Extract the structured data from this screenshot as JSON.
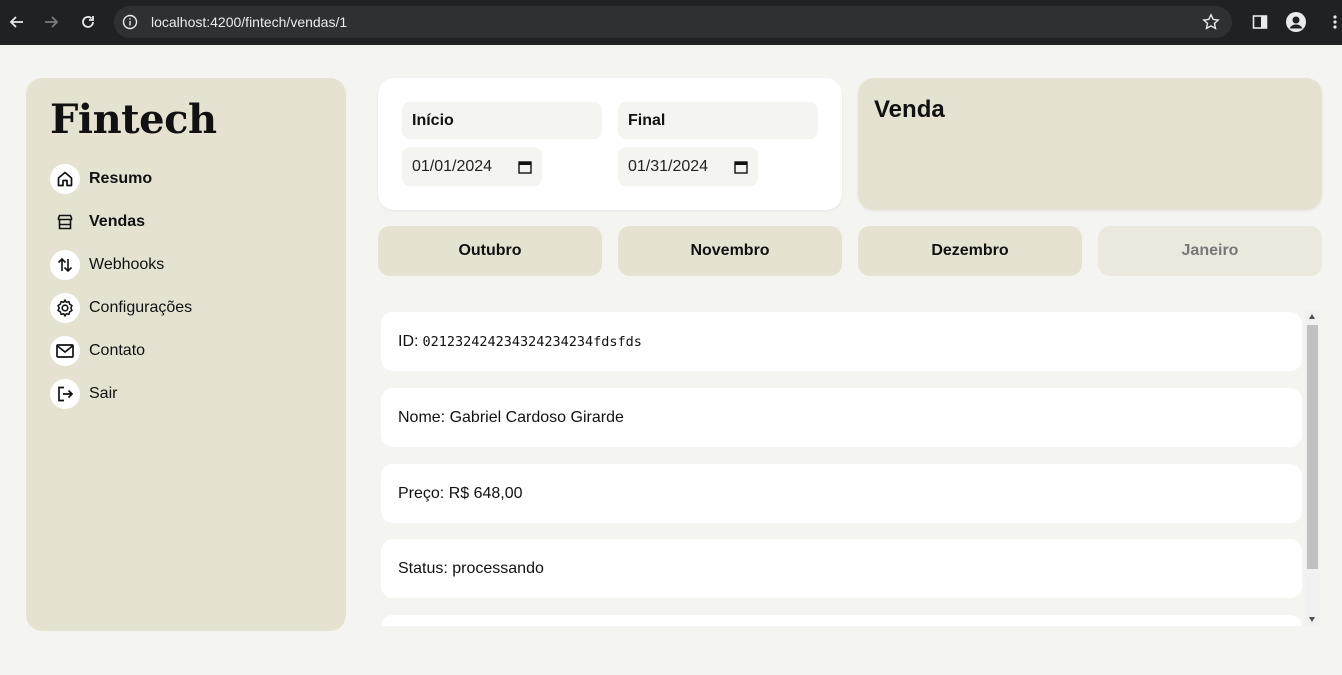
{
  "browser": {
    "url": "localhost:4200/fintech/vendas/1"
  },
  "sidebar": {
    "logo": "Fintech",
    "items": [
      {
        "label": "Resumo",
        "icon": "home-icon"
      },
      {
        "label": "Vendas",
        "icon": "store-icon"
      },
      {
        "label": "Webhooks",
        "icon": "arrows-icon"
      },
      {
        "label": "Configurações",
        "icon": "gear-icon"
      },
      {
        "label": "Contato",
        "icon": "mail-icon"
      },
      {
        "label": "Sair",
        "icon": "logout-icon"
      }
    ]
  },
  "date_range": {
    "start_label": "Início",
    "start_value": "01/01/2024",
    "end_label": "Final",
    "end_value": "01/31/2024"
  },
  "venda_panel": {
    "title": "Venda"
  },
  "months": [
    "Outubro",
    "Novembro",
    "Dezembro",
    "Janeiro"
  ],
  "sale": {
    "id_label": "ID:",
    "id_value": "021232424234324234234fdsfds",
    "nome": "Nome: Gabriel Cardoso Girarde",
    "preco": "Preço: R$ 648,00",
    "status": "Status: processando"
  },
  "colors": {
    "beige": "#e5e2d2",
    "background": "#f4f5f0",
    "chrome": "#202124"
  }
}
